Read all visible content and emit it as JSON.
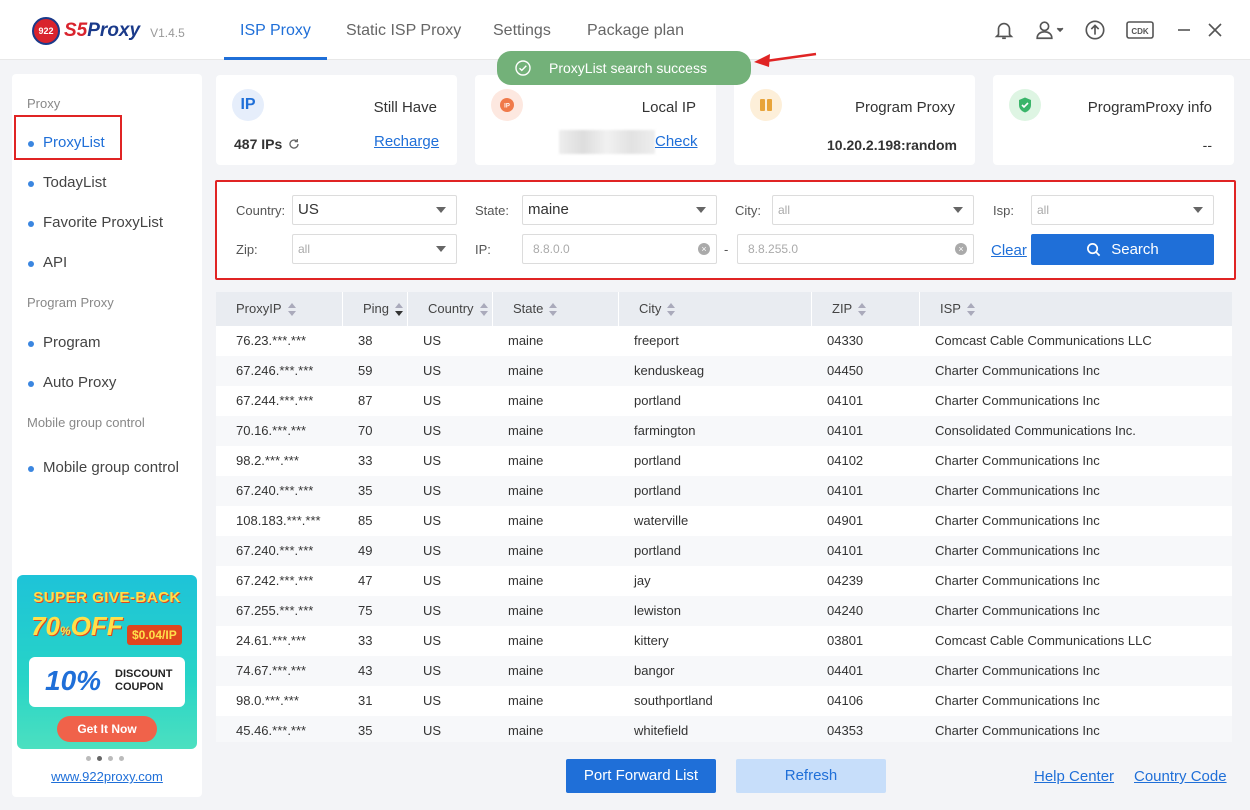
{
  "app": {
    "logo_globe": "922",
    "logo_s5": "S5",
    "logo_name": "Proxy",
    "version": "V1.4.5"
  },
  "tabs": [
    {
      "label": "ISP Proxy",
      "active": true
    },
    {
      "label": "Static ISP Proxy"
    },
    {
      "label": "Settings"
    },
    {
      "label": "Package plan"
    }
  ],
  "header_icons": [
    "bell-icon",
    "user-icon",
    "upload-icon",
    "cdk-icon",
    "minimize-icon",
    "close-icon"
  ],
  "header_cdk_label": "CDK",
  "toast": {
    "text": "ProxyList search success",
    "color": "#73b179"
  },
  "sidebar": {
    "sections": [
      {
        "title": "Proxy",
        "items": [
          "ProxyList",
          "TodayList",
          "Favorite ProxyList",
          "API"
        ]
      },
      {
        "title": "Program Proxy",
        "items": [
          "Program",
          "Auto Proxy"
        ]
      },
      {
        "title": "Mobile group control",
        "items": [
          "Mobile group control"
        ]
      }
    ],
    "active_item": "ProxyList",
    "banner": {
      "title": "SUPER GIVE-BACK",
      "off": "70",
      "off_pct": "%",
      "off_word": "OFF",
      "price": "$0.04/IP",
      "coupon_pct": "10%",
      "coupon_line1": "DISCOUNT",
      "coupon_line2": "COUPON",
      "button": "Get It Now"
    },
    "site_link": "www.922proxy.com"
  },
  "cards": {
    "still_have": {
      "label": "Still Have",
      "value": "487 IPs",
      "link": "Recharge",
      "icon_text": "IP"
    },
    "local_ip": {
      "label": "Local IP",
      "link": "Check"
    },
    "program_proxy": {
      "label": "Program Proxy",
      "value": "10.20.2.198:random"
    },
    "program_proxy_info": {
      "label": "ProgramProxy info",
      "value": "--"
    }
  },
  "filter": {
    "country_label": "Country:",
    "country_value": "US",
    "state_label": "State:",
    "state_value": "maine",
    "city_label": "City:",
    "city_placeholder": "all",
    "isp_label": "Isp:",
    "isp_placeholder": "all",
    "zip_label": "Zip:",
    "zip_placeholder": "all",
    "ip_label": "IP:",
    "ip_from": "8.8.0.0",
    "ip_sep": "-",
    "ip_to": "8.8.255.0",
    "clear": "Clear",
    "search": "Search"
  },
  "table": {
    "columns": [
      "ProxyIP",
      "Ping",
      "Country",
      "State",
      "City",
      "ZIP",
      "ISP"
    ],
    "rows": [
      [
        "76.23.***.***",
        "38",
        "US",
        "maine",
        "freeport",
        "04330",
        "Comcast Cable Communications LLC"
      ],
      [
        "67.246.***.***",
        "59",
        "US",
        "maine",
        "kenduskeag",
        "04450",
        "Charter Communications Inc"
      ],
      [
        "67.244.***.***",
        "87",
        "US",
        "maine",
        "portland",
        "04101",
        "Charter Communications Inc"
      ],
      [
        "70.16.***.***",
        "70",
        "US",
        "maine",
        "farmington",
        "04101",
        "Consolidated Communications Inc."
      ],
      [
        "98.2.***.***",
        "33",
        "US",
        "maine",
        "portland",
        "04102",
        "Charter Communications Inc"
      ],
      [
        "67.240.***.***",
        "35",
        "US",
        "maine",
        "portland",
        "04101",
        "Charter Communications Inc"
      ],
      [
        "108.183.***.***",
        "85",
        "US",
        "maine",
        "waterville",
        "04901",
        "Charter Communications Inc"
      ],
      [
        "67.240.***.***",
        "49",
        "US",
        "maine",
        "portland",
        "04101",
        "Charter Communications Inc"
      ],
      [
        "67.242.***.***",
        "47",
        "US",
        "maine",
        "jay",
        "04239",
        "Charter Communications Inc"
      ],
      [
        "67.255.***.***",
        "75",
        "US",
        "maine",
        "lewiston",
        "04240",
        "Charter Communications Inc"
      ],
      [
        "24.61.***.***",
        "33",
        "US",
        "maine",
        "kittery",
        "03801",
        "Comcast Cable Communications LLC"
      ],
      [
        "74.67.***.***",
        "43",
        "US",
        "maine",
        "bangor",
        "04401",
        "Charter Communications Inc"
      ],
      [
        "98.0.***.***",
        "31",
        "US",
        "maine",
        "southportland",
        "04106",
        "Charter Communications Inc"
      ],
      [
        "45.46.***.***",
        "35",
        "US",
        "maine",
        "whitefield",
        "04353",
        "Charter Communications Inc"
      ]
    ]
  },
  "bottom": {
    "port_forward": "Port Forward List",
    "refresh": "Refresh",
    "help": "Help Center",
    "country_code": "Country Code"
  },
  "colors": {
    "accent": "#1f6fd8",
    "highlight_border": "#e02424"
  }
}
